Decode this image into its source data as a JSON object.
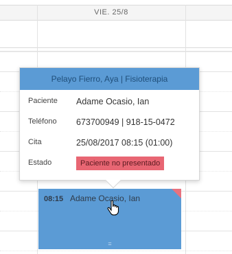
{
  "calendar": {
    "day_header": "VIE. 25/8"
  },
  "popover": {
    "title": "Pelayo Fierro, Aya | Fisioterapia",
    "fields": [
      {
        "label": "Paciente",
        "value": "Adame Ocasio, Ian"
      },
      {
        "label": "Teléfono",
        "value": "673700949 | 918-15-0472"
      },
      {
        "label": "Cita",
        "value": "25/08/2017 08:15 (01:00)"
      },
      {
        "label": "Estado",
        "value": "Paciente no presentado"
      }
    ]
  },
  "event": {
    "time": "08:15",
    "title": "Adame Ocasio, Ian",
    "resize_glyph": "="
  },
  "colors": {
    "event_bg": "#5b9bd5",
    "status_badge": "#e86673",
    "corner_flag": "#e8727e"
  },
  "icons": {
    "cursor": "hand-pointer-icon"
  }
}
